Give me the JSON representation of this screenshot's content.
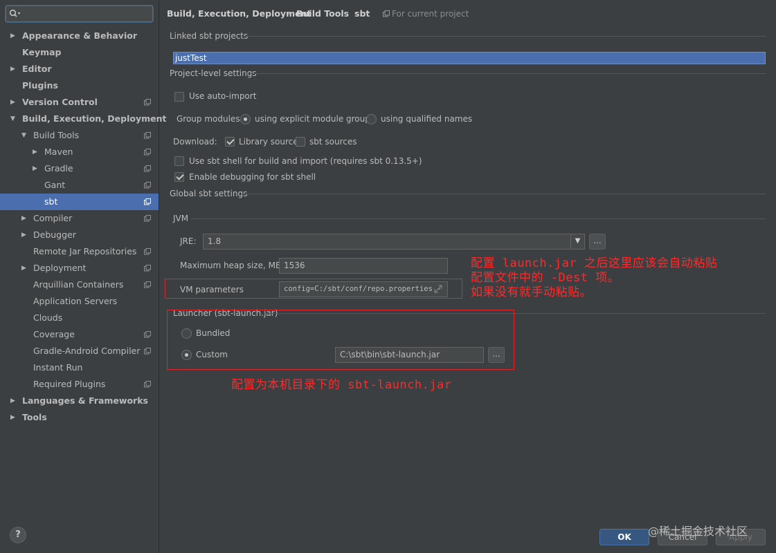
{
  "sidebar": {
    "search_value": "",
    "help_label": "?",
    "items": [
      {
        "label": "Appearance & Behavior",
        "depth": 0,
        "arrow": "▶",
        "bold": true,
        "project": false
      },
      {
        "label": "Keymap",
        "depth": 0,
        "arrow": "",
        "bold": true,
        "project": false
      },
      {
        "label": "Editor",
        "depth": 0,
        "arrow": "▶",
        "bold": true,
        "project": false
      },
      {
        "label": "Plugins",
        "depth": 0,
        "arrow": "",
        "bold": true,
        "project": false
      },
      {
        "label": "Version Control",
        "depth": 0,
        "arrow": "▶",
        "bold": true,
        "project": true
      },
      {
        "label": "Build, Execution, Deployment",
        "depth": 0,
        "arrow": "▼",
        "bold": true,
        "project": false
      },
      {
        "label": "Build Tools",
        "depth": 1,
        "arrow": "▼",
        "bold": false,
        "project": true
      },
      {
        "label": "Maven",
        "depth": 2,
        "arrow": "▶",
        "bold": false,
        "project": true
      },
      {
        "label": "Gradle",
        "depth": 2,
        "arrow": "▶",
        "bold": false,
        "project": true
      },
      {
        "label": "Gant",
        "depth": 2,
        "arrow": "",
        "bold": false,
        "project": true
      },
      {
        "label": "sbt",
        "depth": 2,
        "arrow": "",
        "bold": false,
        "project": true,
        "selected": true
      },
      {
        "label": "Compiler",
        "depth": 1,
        "arrow": "▶",
        "bold": false,
        "project": true
      },
      {
        "label": "Debugger",
        "depth": 1,
        "arrow": "▶",
        "bold": false,
        "project": false
      },
      {
        "label": "Remote Jar Repositories",
        "depth": 1,
        "arrow": "",
        "bold": false,
        "project": true
      },
      {
        "label": "Deployment",
        "depth": 1,
        "arrow": "▶",
        "bold": false,
        "project": true
      },
      {
        "label": "Arquillian Containers",
        "depth": 1,
        "arrow": "",
        "bold": false,
        "project": true
      },
      {
        "label": "Application Servers",
        "depth": 1,
        "arrow": "",
        "bold": false,
        "project": false
      },
      {
        "label": "Clouds",
        "depth": 1,
        "arrow": "",
        "bold": false,
        "project": false
      },
      {
        "label": "Coverage",
        "depth": 1,
        "arrow": "",
        "bold": false,
        "project": true
      },
      {
        "label": "Gradle-Android Compiler",
        "depth": 1,
        "arrow": "",
        "bold": false,
        "project": true
      },
      {
        "label": "Instant Run",
        "depth": 1,
        "arrow": "",
        "bold": false,
        "project": false
      },
      {
        "label": "Required Plugins",
        "depth": 1,
        "arrow": "",
        "bold": false,
        "project": true
      },
      {
        "label": "Languages & Frameworks",
        "depth": 0,
        "arrow": "▶",
        "bold": true,
        "project": false
      },
      {
        "label": "Tools",
        "depth": 0,
        "arrow": "▶",
        "bold": true,
        "project": false
      }
    ]
  },
  "breadcrumb": {
    "part1": "Build, Execution, Deployment",
    "part2": "Build Tools",
    "part3": "sbt",
    "sep": "›",
    "scope": "For current project"
  },
  "linked": {
    "title": "Linked sbt projects",
    "project": "justTest"
  },
  "project_settings": {
    "title": "Project-level settings",
    "auto_import": "Use auto-import",
    "group_label": "Group modules:",
    "group_explicit": "using explicit module groups",
    "group_qualified": "using qualified names",
    "download_label": "Download:",
    "library_sources": "Library sources",
    "sbt_sources": "sbt sources",
    "sbt_shell": "Use sbt shell for build and import (requires sbt 0.13.5+)",
    "debug_shell": "Enable debugging for sbt shell"
  },
  "global": {
    "title": "Global sbt settings",
    "jvm_title": "JVM",
    "jre_label": "JRE:",
    "jre_value": "1.8",
    "heap_label": "Maximum heap size, MB",
    "heap_value": "1536",
    "vm_label": "VM parameters",
    "vm_value": "config=C:/sbt/conf/repo.properties -",
    "browse_label": "..."
  },
  "launcher": {
    "title": "Launcher (sbt-launch.jar)",
    "bundled": "Bundled",
    "custom": "Custom",
    "path": "C:\\sbt\\bin\\sbt-launch.jar",
    "browse_label": "..."
  },
  "annotations": {
    "vm_note": "配置 launch.jar 之后这里应该会自动粘贴\n配置文件中的 -Dest 项。\n如果没有就手动粘贴。",
    "launcher_note": "配置为本机目录下的 sbt-launch.jar"
  },
  "footer": {
    "ok": "OK",
    "cancel": "Cancel",
    "apply": "Apply",
    "watermark": "@稀土掘金技术社区"
  },
  "colors": {
    "background": "#3c3f41",
    "selection": "#4b6eaf",
    "annotation": "#e0262a",
    "ok_button": "#365880"
  }
}
